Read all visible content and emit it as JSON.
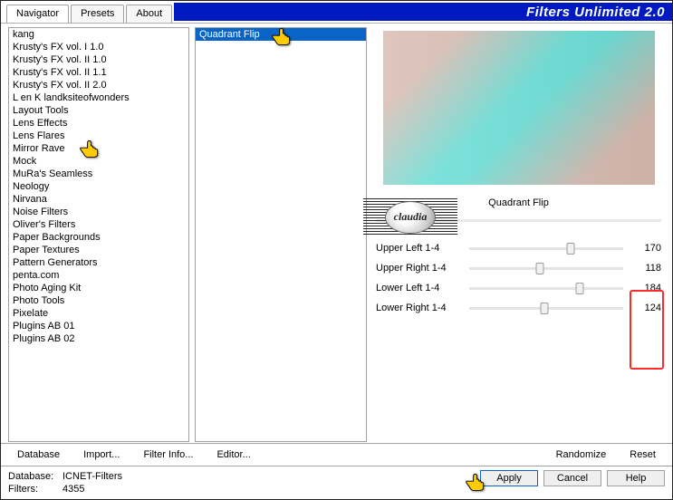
{
  "brand": "Filters Unlimited 2.0",
  "tabs": [
    {
      "label": "Navigator",
      "active": true
    },
    {
      "label": "Presets",
      "active": false
    },
    {
      "label": "About",
      "active": false
    }
  ],
  "categories": [
    "kang",
    "Krusty's FX vol. I 1.0",
    "Krusty's FX vol. II 1.0",
    "Krusty's FX vol. II 1.1",
    "Krusty's FX vol. II 2.0",
    "L en K landksiteofwonders",
    "Layout Tools",
    "Lens Effects",
    "Lens Flares",
    "Mirror Rave",
    "Mock",
    "MuRa's Seamless",
    "Neology",
    "Nirvana",
    "Noise Filters",
    "Oliver's Filters",
    "Paper Backgrounds",
    "Paper Textures",
    "Pattern Generators",
    "penta.com",
    "Photo Aging Kit",
    "Photo Tools",
    "Pixelate",
    "Plugins AB 01",
    "Plugins AB 02"
  ],
  "pointer_categories_index": 9,
  "filters": [
    {
      "label": "Quadrant Flip",
      "selected": true
    }
  ],
  "selected_filter_title": "Quadrant Flip",
  "sliders": [
    {
      "label": "Upper Left 1-4",
      "value": 170,
      "pct": 66
    },
    {
      "label": "Upper Right 1-4",
      "value": 118,
      "pct": 46
    },
    {
      "label": "Lower Left 1-4",
      "value": 184,
      "pct": 72
    },
    {
      "label": "Lower Right 1-4",
      "value": 124,
      "pct": 49
    }
  ],
  "toolbar": {
    "database": "Database",
    "import": "Import...",
    "filter_info": "Filter Info...",
    "editor": "Editor...",
    "randomize": "Randomize",
    "reset": "Reset"
  },
  "actions": {
    "apply": "Apply",
    "cancel": "Cancel",
    "help": "Help"
  },
  "status": {
    "database_key": "Database:",
    "database_val": "ICNET-Filters",
    "filters_key": "Filters:",
    "filters_val": "4355"
  },
  "watermark": "claudia"
}
